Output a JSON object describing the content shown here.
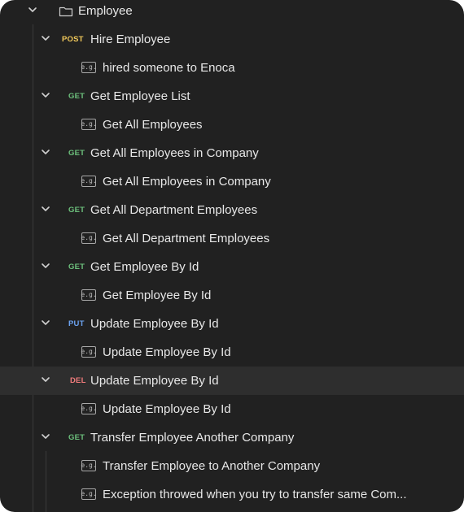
{
  "folder": {
    "name": "Employee",
    "icon": "folder-icon",
    "expanded": true
  },
  "requests": [
    {
      "method": "POST",
      "name": "Hire Employee",
      "example": "hired someone to Enoca"
    },
    {
      "method": "GET",
      "name": "Get Employee List",
      "example": "Get All Employees"
    },
    {
      "method": "GET",
      "name": "Get All Employees in Company",
      "example": "Get All Employees in Company"
    },
    {
      "method": "GET",
      "name": "Get All Department Employees",
      "example": "Get All Department Employees"
    },
    {
      "method": "GET",
      "name": "Get Employee By Id",
      "example": "Get Employee By Id"
    },
    {
      "method": "PUT",
      "name": "Update Employee By Id",
      "example": "Update Employee By Id"
    },
    {
      "method": "DEL",
      "name": "Update Employee By Id",
      "example": "Update Employee By Id"
    },
    {
      "method": "GET",
      "name": "Transfer Employee Another Company",
      "examples": [
        "Transfer Employee to Another Company",
        "Exception throwed when you try to transfer same Com..."
      ]
    }
  ],
  "example_badge": "e.g.",
  "colors": {
    "background": "#212121",
    "highlight": "#2e2e2e",
    "post": "#f0c85a",
    "get": "#6cc07c",
    "put": "#6ca3f0",
    "del": "#f07c7c"
  }
}
